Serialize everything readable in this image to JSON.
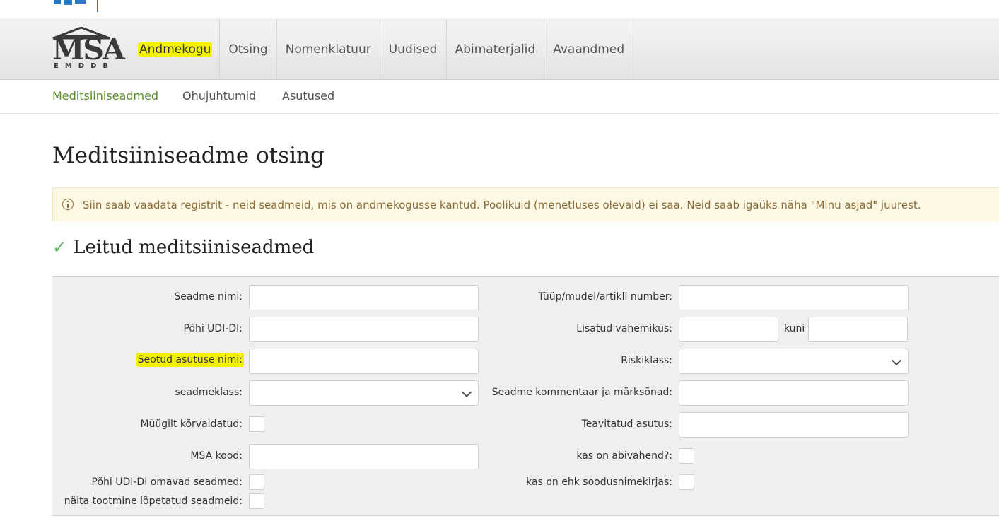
{
  "nav": {
    "logo_text": "MSA",
    "logo_subtext": "EMDDB",
    "items": [
      {
        "label": "Andmekogu"
      },
      {
        "label": "Otsing"
      },
      {
        "label": "Nomenklatuur"
      },
      {
        "label": "Uudised"
      },
      {
        "label": "Abimaterjalid"
      },
      {
        "label": "Avaandmed"
      }
    ]
  },
  "subnav": {
    "items": [
      {
        "label": "Meditsiiniseadmed"
      },
      {
        "label": "Ohujuhtumid"
      },
      {
        "label": "Asutused"
      }
    ]
  },
  "page": {
    "title": "Meditsiiniseadme otsing",
    "info": "Siin saab vaadata registrit - neid seadmeid, mis on andmekogusse kantud. Poolikuid (menetluses olevaid) ei saa. Neid saab igaüks näha \"Minu asjad\" juurest.",
    "section_title": "Leitud meditsiiniseadmed",
    "check_symbol": "✓"
  },
  "filters": {
    "left": {
      "device_name": "Seadme nimi:",
      "basic_udi": "Põhi UDI-DI:",
      "linked_org": "Seotud asutuse nimi:",
      "device_class": "seadmeklass:",
      "withdrawn": "Müügilt kõrvaldatud:",
      "msa_code": "MSA kood:",
      "has_basic_udi": "Põhi UDI-DI omavad seadmed:",
      "show_discontinued": "näita tootmine lõpetatud seadmeid:"
    },
    "right": {
      "type_model": "Tüüp/mudel/artikli number:",
      "added_range": "Lisatud vahemikus:",
      "range_to": "kuni",
      "risk_class": "Riskiklass:",
      "comment_keywords": "Seadme kommentaar ja märksõnad:",
      "notified_org": "Teavitatud asutus:",
      "is_aid": "kas on abivahend?:",
      "is_discount_list": "kas on ehk soodusnimekirjas:"
    }
  }
}
